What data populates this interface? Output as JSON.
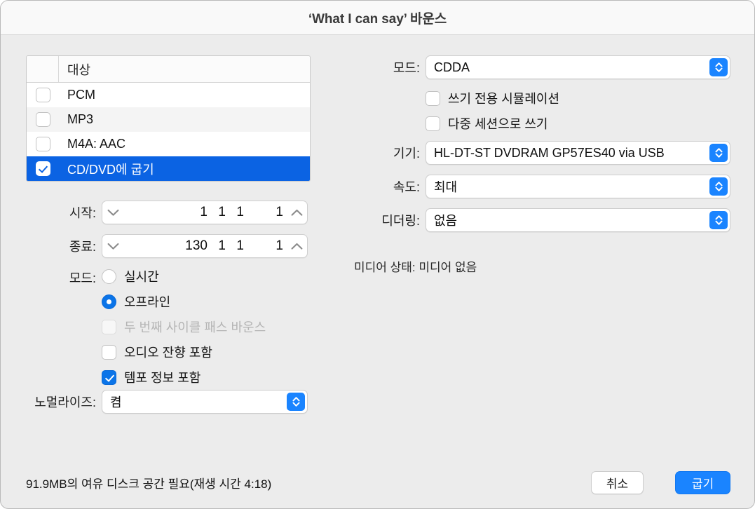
{
  "window": {
    "title": "‘What I can say’ 바운스"
  },
  "destination_table": {
    "header_name": "대상",
    "rows": [
      {
        "label": "PCM",
        "checked": false,
        "selected": false
      },
      {
        "label": "MP3",
        "checked": false,
        "selected": false
      },
      {
        "label": "M4A: AAC",
        "checked": false,
        "selected": false
      },
      {
        "label": "CD/DVD에 굽기",
        "checked": true,
        "selected": true
      }
    ]
  },
  "position": {
    "start_label": "시작:",
    "start_value": {
      "bar": "1",
      "beat": "1",
      "division": "1",
      "tick": "1"
    },
    "end_label": "종료:",
    "end_value": {
      "bar": "130",
      "beat": "1",
      "division": "1",
      "tick": "1"
    }
  },
  "mode_left": {
    "label": "모드:",
    "options": [
      {
        "label": "실시간",
        "selected": false
      },
      {
        "label": "오프라인",
        "selected": true
      }
    ]
  },
  "bounce_options": [
    {
      "label": "두 번째 사이클 패스 바운스",
      "checked": false,
      "disabled": true
    },
    {
      "label": "오디오 잔향 포함",
      "checked": false,
      "disabled": false
    },
    {
      "label": "템포 정보 포함",
      "checked": true,
      "disabled": false
    }
  ],
  "normalize": {
    "label": "노멀라이즈:",
    "value": "켬"
  },
  "burn": {
    "mode_label": "모드:",
    "mode_value": "CDDA",
    "write_options": [
      {
        "label": "쓰기 전용 시뮬레이션",
        "checked": false
      },
      {
        "label": "다중 세션으로 쓰기",
        "checked": false
      }
    ],
    "device_label": "기기:",
    "device_value": "HL-DT-ST DVDRAM GP57ES40 via USB",
    "speed_label": "속도:",
    "speed_value": "최대",
    "dithering_label": "디더링:",
    "dithering_value": "없음",
    "media_status": "미디어 상태: 미디어 없음"
  },
  "footer": {
    "note": "91.9MB의 여유 디스크 공간 필요(재생 시간 4:18)",
    "cancel_label": "취소",
    "burn_label": "굽기"
  },
  "colors": {
    "accent_blue": "#1a84ff",
    "selection_blue": "#0b63e3",
    "window_bg": "#ececec",
    "titlebar_bg": "#f9f9f9"
  }
}
